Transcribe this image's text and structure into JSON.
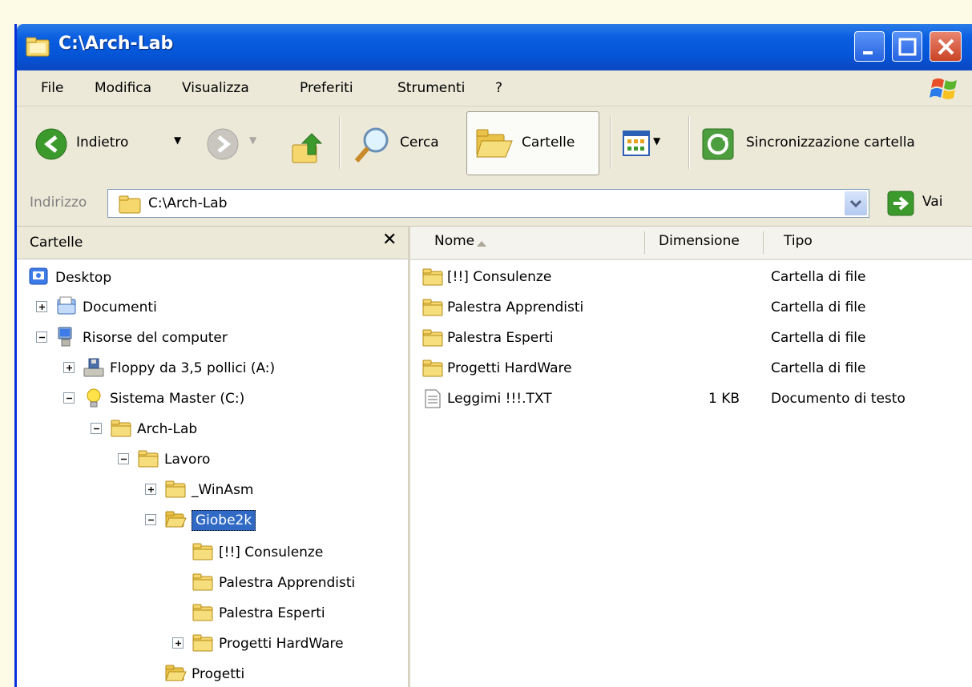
{
  "window": {
    "title": "C:\\Arch-Lab"
  },
  "menu": [
    "File",
    "Modifica",
    "Visualizza",
    "Preferiti",
    "Strumenti",
    "?"
  ],
  "toolbar": {
    "back_label": "Indietro",
    "search_label": "Cerca",
    "folders_label": "Cartelle",
    "sync_label": "Sincronizzazione cartella"
  },
  "address": {
    "label": "Indirizzo",
    "value": "C:\\Arch-Lab",
    "go_label": "Vai"
  },
  "left_pane": {
    "title": "Cartelle",
    "close_glyph": "✕",
    "tree": [
      {
        "label": "Desktop",
        "icon": "desktop-icon",
        "expander": null
      },
      {
        "label": "Documenti",
        "icon": "documents-icon",
        "expander": "plus"
      },
      {
        "label": "Risorse del computer",
        "icon": "computer-icon",
        "expander": "minus"
      },
      {
        "label": "Floppy da 3,5 pollici (A:)",
        "icon": "floppy-icon",
        "expander": "plus"
      },
      {
        "label": "Sistema Master (C:)",
        "icon": "drive-bulb-icon",
        "expander": "minus"
      },
      {
        "label": "Arch-Lab",
        "icon": "folder-icon",
        "expander": "minus"
      },
      {
        "label": "Lavoro",
        "icon": "folder-icon",
        "expander": "minus"
      },
      {
        "label": "_WinAsm",
        "icon": "folder-icon",
        "expander": "plus"
      },
      {
        "label": "Giobe2k",
        "icon": "folder-open-icon",
        "expander": "minus",
        "selected": true
      },
      {
        "label": "[!!] Consulenze",
        "icon": "folder-icon",
        "expander": null
      },
      {
        "label": "Palestra Apprendisti",
        "icon": "folder-icon",
        "expander": null
      },
      {
        "label": "Palestra Esperti",
        "icon": "folder-icon",
        "expander": null
      },
      {
        "label": "Progetti HardWare",
        "icon": "folder-icon",
        "expander": "plus"
      },
      {
        "label": "Progetti",
        "icon": "folder-open-icon",
        "expander": null
      }
    ]
  },
  "right_pane": {
    "columns": [
      "Nome",
      "Dimensione",
      "Tipo"
    ],
    "files": [
      {
        "name": "[!!] Consulenze",
        "size": "",
        "type": "Cartella di file",
        "icon": "folder-icon"
      },
      {
        "name": "Palestra Apprendisti",
        "size": "",
        "type": "Cartella di file",
        "icon": "folder-icon"
      },
      {
        "name": "Palestra Esperti",
        "size": "",
        "type": "Cartella di file",
        "icon": "folder-icon"
      },
      {
        "name": "Progetti HardWare",
        "size": "",
        "type": "Cartella di file",
        "icon": "folder-icon"
      },
      {
        "name": "Leggimi !!!.TXT",
        "size": "1 KB",
        "type": "Documento di testo",
        "icon": "text-file-icon"
      }
    ]
  },
  "colors": {
    "titlebar": "#0554d6",
    "selection": "#316ac5",
    "chrome": "#ece9d8"
  }
}
